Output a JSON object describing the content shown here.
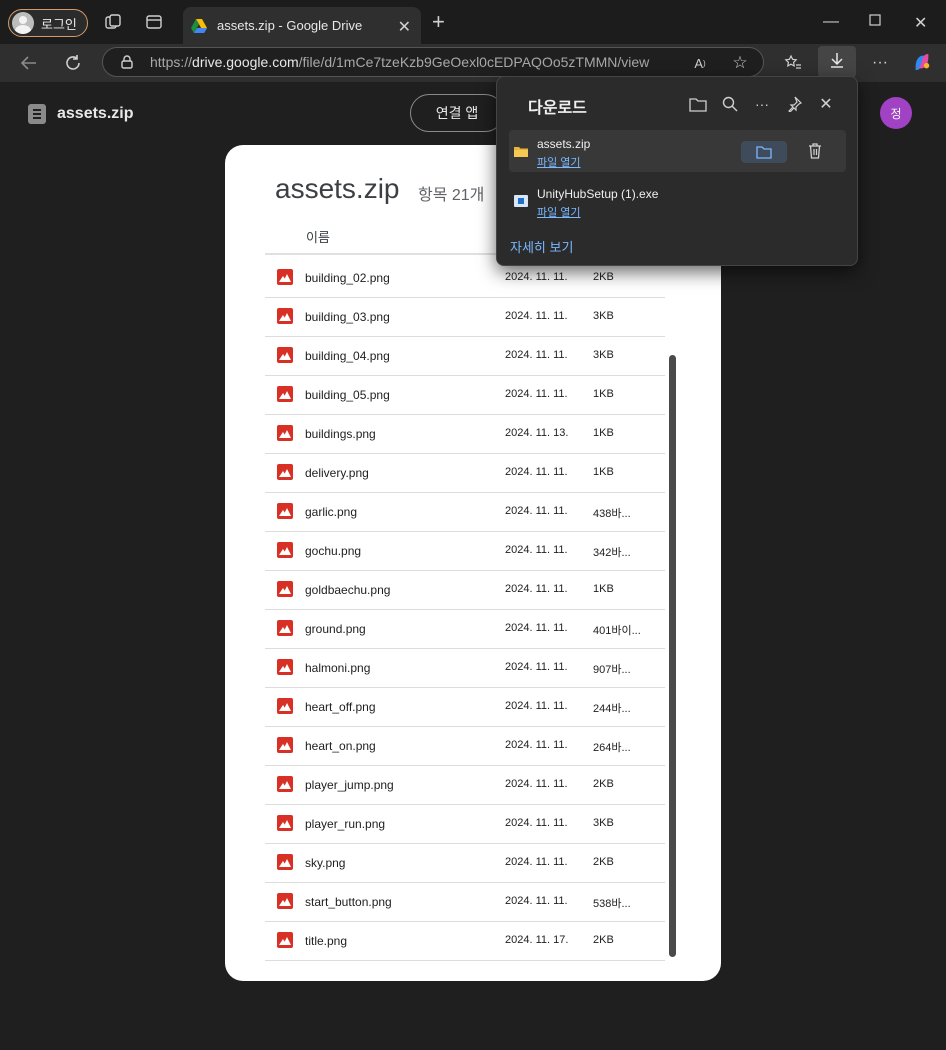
{
  "browser": {
    "profile_label": "로그인",
    "tab_title": "assets.zip - Google Drive",
    "url_prefix": "https://",
    "url_host": "drive.google.com",
    "url_path": "/file/d/1mCe7tzeKzb9GeOexl0cEDPAQOo5zTMMN/view",
    "icons": [
      "workspaces-icon",
      "tab-actions-icon",
      "google-drive-icon",
      "close-icon",
      "plus-icon",
      "minimize-icon",
      "maximize-icon",
      "close-window-icon",
      "back-arrow-icon",
      "refresh-icon",
      "lock-icon",
      "read-aloud-icon",
      "star-icon",
      "favorites-icon",
      "download-icon",
      "more-icon",
      "copilot-icon"
    ]
  },
  "drive": {
    "file_name": "assets.zip",
    "connect_app_label": "연결 앱",
    "avatar_letter": "정"
  },
  "archive": {
    "title": "assets.zip",
    "item_count": "항목 21개",
    "column_name": "이름",
    "files": [
      {
        "name": "building_02.png",
        "date": "2024. 11. 11.",
        "size": "2KB"
      },
      {
        "name": "building_03.png",
        "date": "2024. 11. 11.",
        "size": "3KB"
      },
      {
        "name": "building_04.png",
        "date": "2024. 11. 11.",
        "size": "3KB"
      },
      {
        "name": "building_05.png",
        "date": "2024. 11. 11.",
        "size": "1KB"
      },
      {
        "name": "buildings.png",
        "date": "2024. 11. 13.",
        "size": "1KB"
      },
      {
        "name": "delivery.png",
        "date": "2024. 11. 11.",
        "size": "1KB"
      },
      {
        "name": "garlic.png",
        "date": "2024. 11. 11.",
        "size": "438바..."
      },
      {
        "name": "gochu.png",
        "date": "2024. 11. 11.",
        "size": "342바..."
      },
      {
        "name": "goldbaechu.png",
        "date": "2024. 11. 11.",
        "size": "1KB"
      },
      {
        "name": "ground.png",
        "date": "2024. 11. 11.",
        "size": "401바이..."
      },
      {
        "name": "halmoni.png",
        "date": "2024. 11. 11.",
        "size": "907바..."
      },
      {
        "name": "heart_off.png",
        "date": "2024. 11. 11.",
        "size": "244바..."
      },
      {
        "name": "heart_on.png",
        "date": "2024. 11. 11.",
        "size": "264바..."
      },
      {
        "name": "player_jump.png",
        "date": "2024. 11. 11.",
        "size": "2KB"
      },
      {
        "name": "player_run.png",
        "date": "2024. 11. 11.",
        "size": "3KB"
      },
      {
        "name": "sky.png",
        "date": "2024. 11. 11.",
        "size": "2KB"
      },
      {
        "name": "start_button.png",
        "date": "2024. 11. 11.",
        "size": "538바..."
      },
      {
        "name": "title.png",
        "date": "2024. 11. 17.",
        "size": "2KB"
      }
    ]
  },
  "downloads": {
    "title": "다운로드",
    "items": [
      {
        "name": "assets.zip",
        "action": "파일 열기"
      },
      {
        "name": "UnityHubSetup (1).exe",
        "action": "파일 열기"
      }
    ],
    "more_label": "자세히 보기"
  },
  "colors": {
    "accent_link": "#7ab8ff",
    "image_icon": "#d93025",
    "avatar": "#a142c4"
  }
}
